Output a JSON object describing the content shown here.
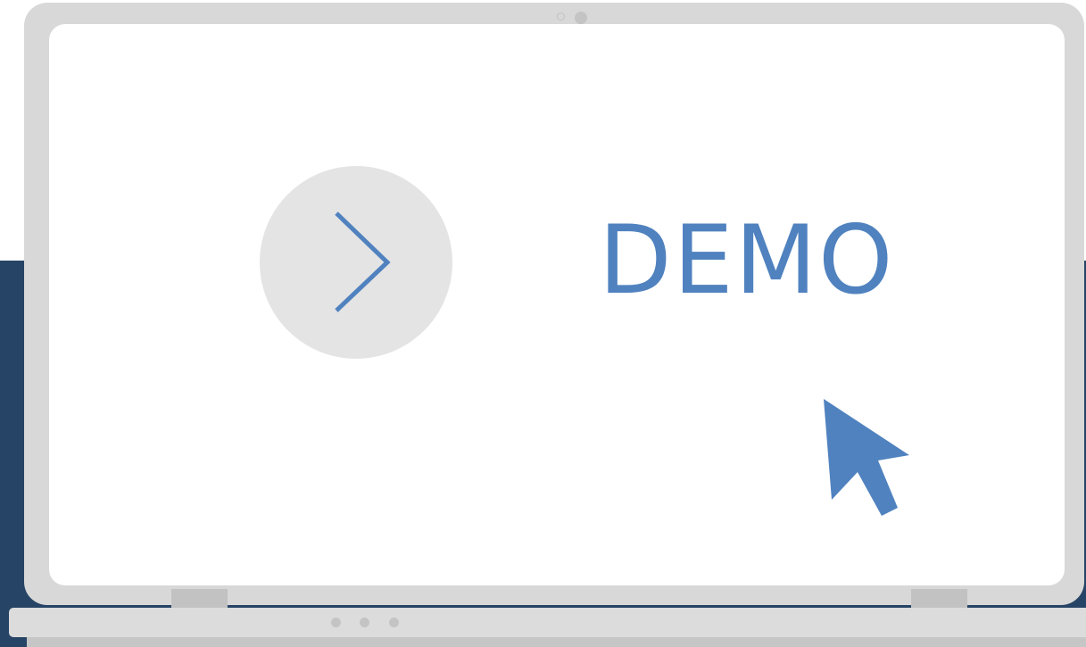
{
  "illustration": {
    "play_icon": "chevron-right-icon",
    "demo_label": "DEMO",
    "cursor_icon": "mouse-pointer-icon",
    "camera_icon": "webcam-icon",
    "indicator_lights": 3
  },
  "colors": {
    "accent": "#5082bf",
    "backdrop": "#264466",
    "laptop_frame": "#d8d8d8",
    "play_circle": "#e4e4e4"
  }
}
